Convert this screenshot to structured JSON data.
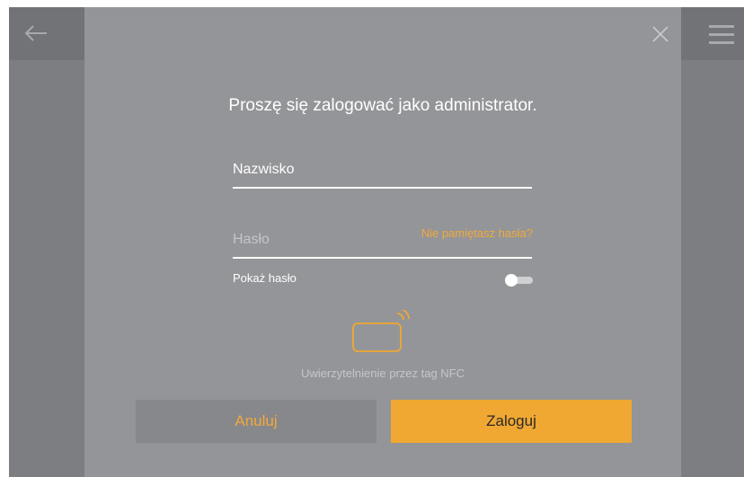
{
  "icons": {
    "back": "arrow-left",
    "menu": "hamburger-menu",
    "close": "close-x",
    "nfc": "nfc-card"
  },
  "colors": {
    "accent": "#f0a832",
    "screen_bg": "#7d7e82",
    "modal_bg": "#949598"
  },
  "login": {
    "title": "Proszę się zalogować jako administrator.",
    "name_placeholder": "Nazwisko",
    "password_placeholder": "Hasło",
    "forgot_label": "Nie pamiętasz hasła?",
    "show_password_label": "Pokaż hasło",
    "show_password_enabled": false,
    "nfc_label": "Uwierzytelnienie przez tag NFC",
    "cancel_label": "Anuluj",
    "login_label": "Zaloguj"
  }
}
